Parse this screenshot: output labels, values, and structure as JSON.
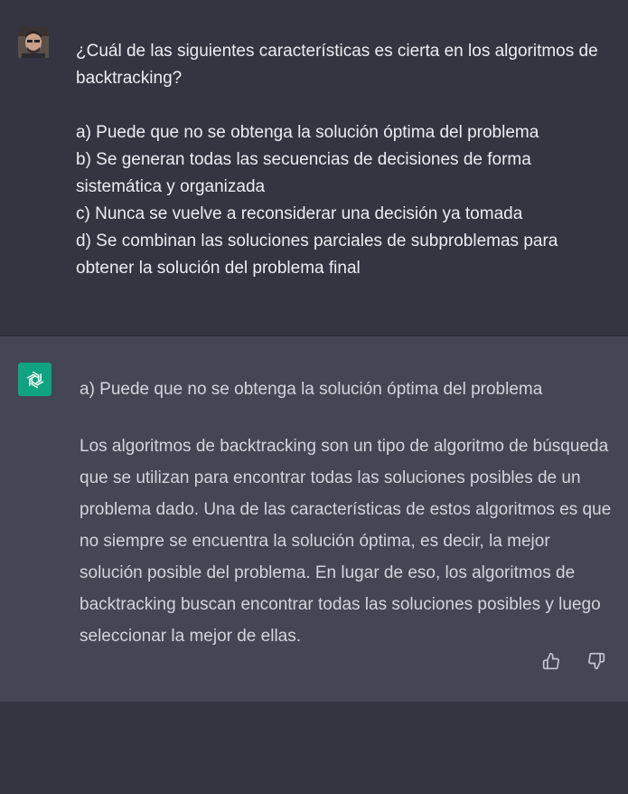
{
  "user": {
    "question": "¿Cuál de las siguientes características es cierta en los algoritmos de backtracking?",
    "options": [
      "a) Puede que no se obtenga la solución óptima del problema",
      "b) Se generan todas las secuencias de decisiones de forma sistemática y organizada",
      "c) Nunca se vuelve a reconsiderar una decisión ya tomada",
      "d) Se combinan las soluciones parciales de subproblemas para obtener la solución del problema final"
    ]
  },
  "assistant": {
    "answer": "a) Puede que no se obtenga la solución óptima del problema",
    "explanation": "Los algoritmos de backtracking son un tipo de algoritmo de búsqueda que se utilizan para encontrar todas las soluciones posibles de un problema dado. Una de las características de estos algoritmos es que no siempre se encuentra la solución óptima, es decir, la mejor solución posible del problema. En lugar de eso, los algoritmos de backtracking buscan encontrar todas las soluciones posibles y luego seleccionar la mejor de ellas."
  },
  "icons": {
    "user_avatar": "user-avatar",
    "assistant_avatar": "openai-logo-icon",
    "thumbs_up": "thumbs-up-icon",
    "thumbs_down": "thumbs-down-icon"
  },
  "colors": {
    "page_bg": "#343541",
    "assistant_bg": "#444654",
    "brand": "#10a37f",
    "user_text": "#ececf1",
    "assistant_text": "#d1d5db"
  }
}
